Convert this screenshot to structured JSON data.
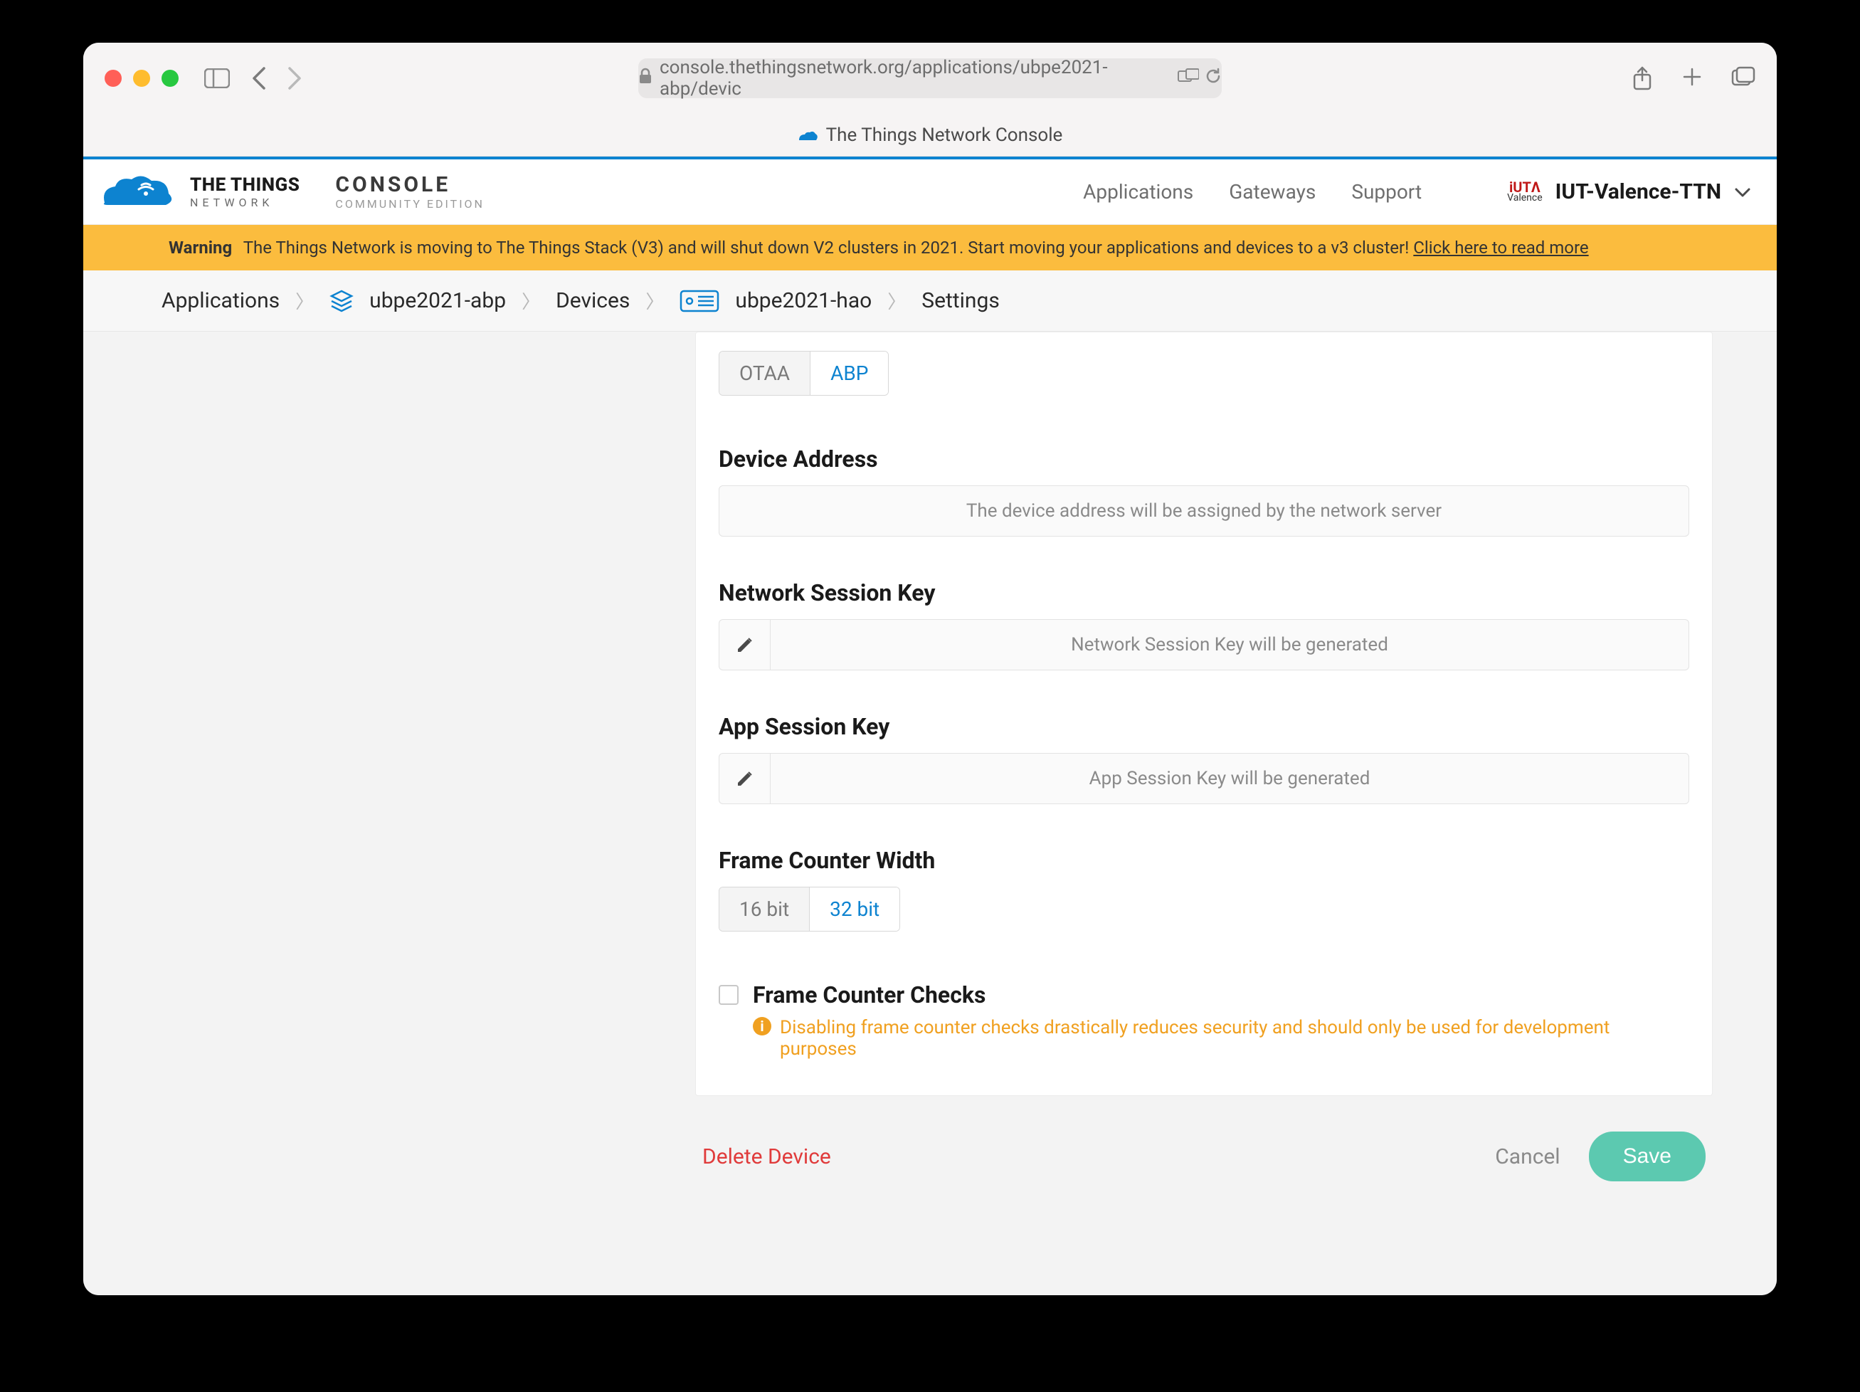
{
  "browser": {
    "url": "console.thethingsnetwork.org/applications/ubpe2021-abp/devic",
    "tab_title": "The Things Network Console"
  },
  "header": {
    "logo_line1": "THE THINGS",
    "logo_line2": "NETWORK",
    "console_line1": "CONSOLE",
    "console_line2": "COMMUNITY EDITION",
    "nav": {
      "applications": "Applications",
      "gateways": "Gateways",
      "support": "Support"
    },
    "user": {
      "org_label_top": "iUTΛ",
      "org_label_bottom": "Valence",
      "name": "IUT-Valence-TTN"
    }
  },
  "banner": {
    "label": "Warning",
    "text": "The Things Network is moving to The Things Stack (V3) and will shut down V2 clusters in 2021. Start moving your applications and devices to a v3 cluster! ",
    "link": "Click here to read more"
  },
  "breadcrumb": {
    "applications": "Applications",
    "app_id": "ubpe2021-abp",
    "devices": "Devices",
    "device_id": "ubpe2021-hao",
    "settings": "Settings"
  },
  "tabs": {
    "otaa": "OTAA",
    "abp": "ABP"
  },
  "fields": {
    "device_address": {
      "label": "Device Address",
      "placeholder": "The device address will be assigned by the network server"
    },
    "network_session_key": {
      "label": "Network Session Key",
      "placeholder": "Network Session Key will be generated"
    },
    "app_session_key": {
      "label": "App Session Key",
      "placeholder": "App Session Key will be generated"
    },
    "frame_counter_width": {
      "label": "Frame Counter Width",
      "opt_16": "16 bit",
      "opt_32": "32 bit"
    },
    "frame_counter_checks": {
      "label": "Frame Counter Checks",
      "help": "Disabling frame counter checks drastically reduces security and should only be used for development purposes"
    }
  },
  "footer": {
    "delete": "Delete Device",
    "cancel": "Cancel",
    "save": "Save"
  }
}
